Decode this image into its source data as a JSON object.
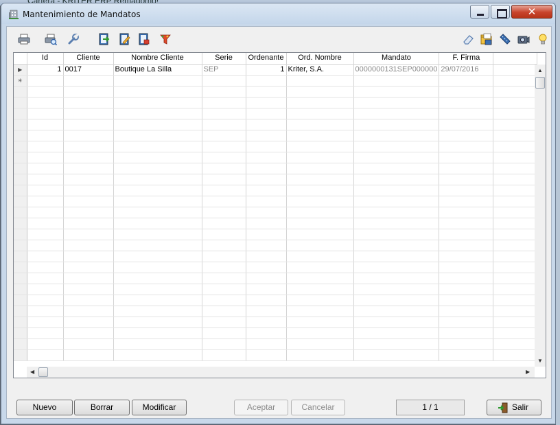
{
  "background": {
    "text": "Cartera - KRITER ERP  Remadomo!"
  },
  "window": {
    "title": "Mantenimiento de Mandatos",
    "colors": {
      "close": "#c8432c",
      "title_bg": "#c4d6ea"
    }
  },
  "toolbar": {
    "left_icons": [
      "print-icon",
      "print-preview-icon",
      "wrench-icon",
      "export-icon",
      "edit-icon",
      "document-icon",
      "filter-icon"
    ],
    "right_icons": [
      "eraser-icon",
      "folder-icon",
      "ruler-icon",
      "camera-icon",
      "lightbulb-icon"
    ]
  },
  "grid": {
    "columns": [
      "Id",
      "Cliente",
      "Nombre Cliente",
      "Serie",
      "Ordenante",
      "Ord. Nombre",
      "Mandato",
      "F. Firma"
    ],
    "rows": [
      [
        "1",
        "0017",
        "Boutique La Silla",
        "SEP",
        "1",
        "Kriter, S.A.",
        "0000000131SEP000000",
        "29/07/2016"
      ]
    ]
  },
  "buttons": {
    "nuevo": {
      "label": "Nuevo"
    },
    "borrar": {
      "label": "Borrar"
    },
    "modificar": {
      "label": "Modificar"
    },
    "aceptar": {
      "label": "Aceptar"
    },
    "cancelar": {
      "label": "Cancelar"
    },
    "salir": {
      "label": "Salir"
    }
  },
  "pager": {
    "text": "1 / 1"
  }
}
